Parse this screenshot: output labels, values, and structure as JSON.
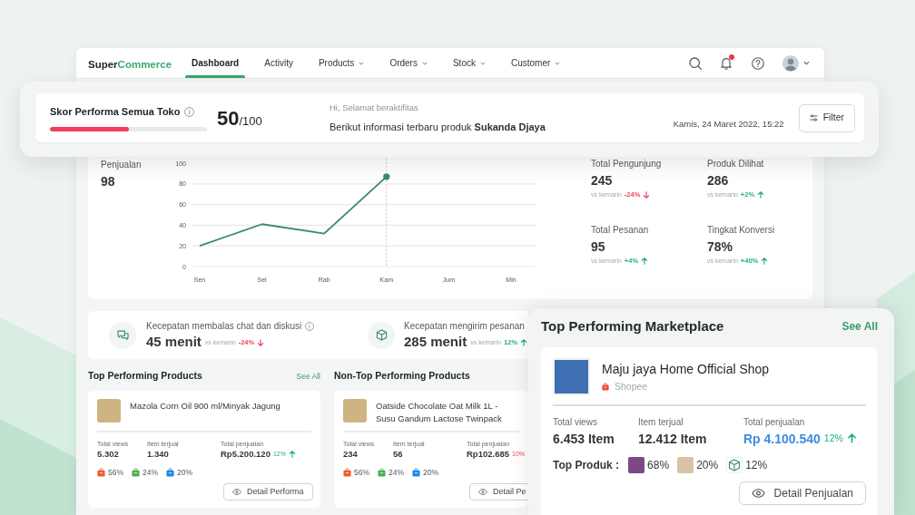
{
  "nav": {
    "logo": {
      "part_1": "Super",
      "part_2": "Commerce"
    },
    "items": [
      {
        "label": "Dashboard",
        "selected": true,
        "dropdown": false
      },
      {
        "label": "Activity",
        "selected": false,
        "dropdown": false
      },
      {
        "label": "Products",
        "selected": false,
        "dropdown": true
      },
      {
        "label": "Orders",
        "selected": false,
        "dropdown": true
      },
      {
        "label": "Stock",
        "selected": false,
        "dropdown": true
      },
      {
        "label": "Customer",
        "selected": false,
        "dropdown": true
      }
    ],
    "notifications": {
      "unread": true
    }
  },
  "score": {
    "title": "Skor Performa Semua Toko",
    "level": 0.5,
    "value": "50",
    "max": "/100",
    "greeting": "Hi, Selamat beraktifitas",
    "message": "Berikut informasi terbaru produk **Sukanda Djaya**",
    "date": "Kamis, 24 Maret 2022, 15:22",
    "filter_button": "Filter"
  },
  "sales": {
    "label": "Penjualan",
    "value": "98",
    "chart_data": {
      "type": "line",
      "categories": [
        "Sen",
        "Sel",
        "Rab",
        "Kam",
        "Jum",
        "Min"
      ],
      "series": [
        {
          "color": "#3d8a66",
          "values": [
            20,
            41,
            32,
            87,
            null,
            null
          ]
        }
      ],
      "ylim": [
        0,
        100
      ],
      "yticks": [
        0,
        20,
        40,
        60,
        80,
        100
      ],
      "grid": true,
      "ref_lines": [
        {
          "axis": "x",
          "value": "Kam"
        }
      ]
    }
  },
  "stats": [
    {
      "label": "Total Pengunjung",
      "value": "245",
      "compare": "vs kemarin",
      "delta": "-24%",
      "up": false,
      "arrow": true
    },
    {
      "label": "Produk Dilihat",
      "value": "286",
      "compare": "vs kemarin",
      "delta": "+2%",
      "up": true,
      "arrow": true
    },
    {
      "label": "Total Pesanan",
      "value": "95",
      "compare": "vs kemarin",
      "delta": "+4%",
      "up": true,
      "arrow": true
    },
    {
      "label": "Tingkat Konversi",
      "value": "78%",
      "compare": "vs kemarin",
      "delta": "+40%",
      "up": true,
      "arrow": true
    }
  ],
  "speed": [
    {
      "kind": "chat",
      "label": "Kecepatan membalas chat dan diskusi",
      "info": true,
      "value": "45 menit",
      "compare": "vs kemarin",
      "delta": "-24%",
      "up": false,
      "arrow": true
    },
    {
      "kind": "package",
      "label": "Kecepatan mengirim pesanan",
      "info": false,
      "value": "285 menit",
      "compare": "vs kemarin",
      "delta": "12%",
      "up": true,
      "arrow": true
    }
  ],
  "top_products": {
    "title": "Top Performing Products",
    "see_all": "See All",
    "items": [
      {
        "name": "Mazola Corn Oil 900 ml/Minyak Jagung",
        "stats": [
          {
            "label": "Total views",
            "value": "5.302"
          },
          {
            "label": "Item terjual",
            "value": "1.340"
          },
          {
            "label": "Total penjualan",
            "value": "Rp5.200.120",
            "delta": "12%",
            "up": true,
            "arrow": true
          }
        ],
        "shares": [
          {
            "value": "56%",
            "color": "#f1582c"
          },
          {
            "value": "24%",
            "color": "#4caf50"
          },
          {
            "value": "20%",
            "color": "#1e88e5"
          }
        ],
        "button": "Detail Performa"
      }
    ]
  },
  "non_top_products": {
    "title": "Non-Top Performing Products",
    "items": [
      {
        "name": "Oatside Chocolate Oat Milk 1L - Susu Gandum Lactose Twinpack",
        "stats": [
          {
            "label": "Total views",
            "value": "234"
          },
          {
            "label": "Item terjual",
            "value": "56"
          },
          {
            "label": "Total penjualan",
            "value": "Rp102.685",
            "delta": "10%",
            "up": false,
            "arrow": false
          }
        ],
        "shares": [
          {
            "value": "56%",
            "color": "#f1582c"
          },
          {
            "value": "24%",
            "color": "#4caf50"
          },
          {
            "value": "20%",
            "color": "#1e88e5"
          }
        ],
        "button": "Detail Pe"
      }
    ]
  },
  "marketplace": {
    "title": "Top Performing Marketplace",
    "see_all": "See All",
    "shop": {
      "name": "Maju jaya Home Official Shop",
      "platform": "Shopee"
    },
    "stats": [
      {
        "label": "Total views",
        "value": "6.453 Item"
      },
      {
        "label": "Item terjual",
        "value": "12.412 Item"
      },
      {
        "label": "Total penjualan",
        "value": "Rp 4.100.540",
        "delta": "12%",
        "up": true,
        "arrow": true
      }
    ],
    "top_products": {
      "label": "Top Produk :",
      "items": [
        {
          "kind": "photo",
          "share": "68%"
        },
        {
          "kind": "photo",
          "share": "20%"
        },
        {
          "kind": "box",
          "share": "12%"
        }
      ]
    },
    "button": "Detail Penjualan"
  }
}
